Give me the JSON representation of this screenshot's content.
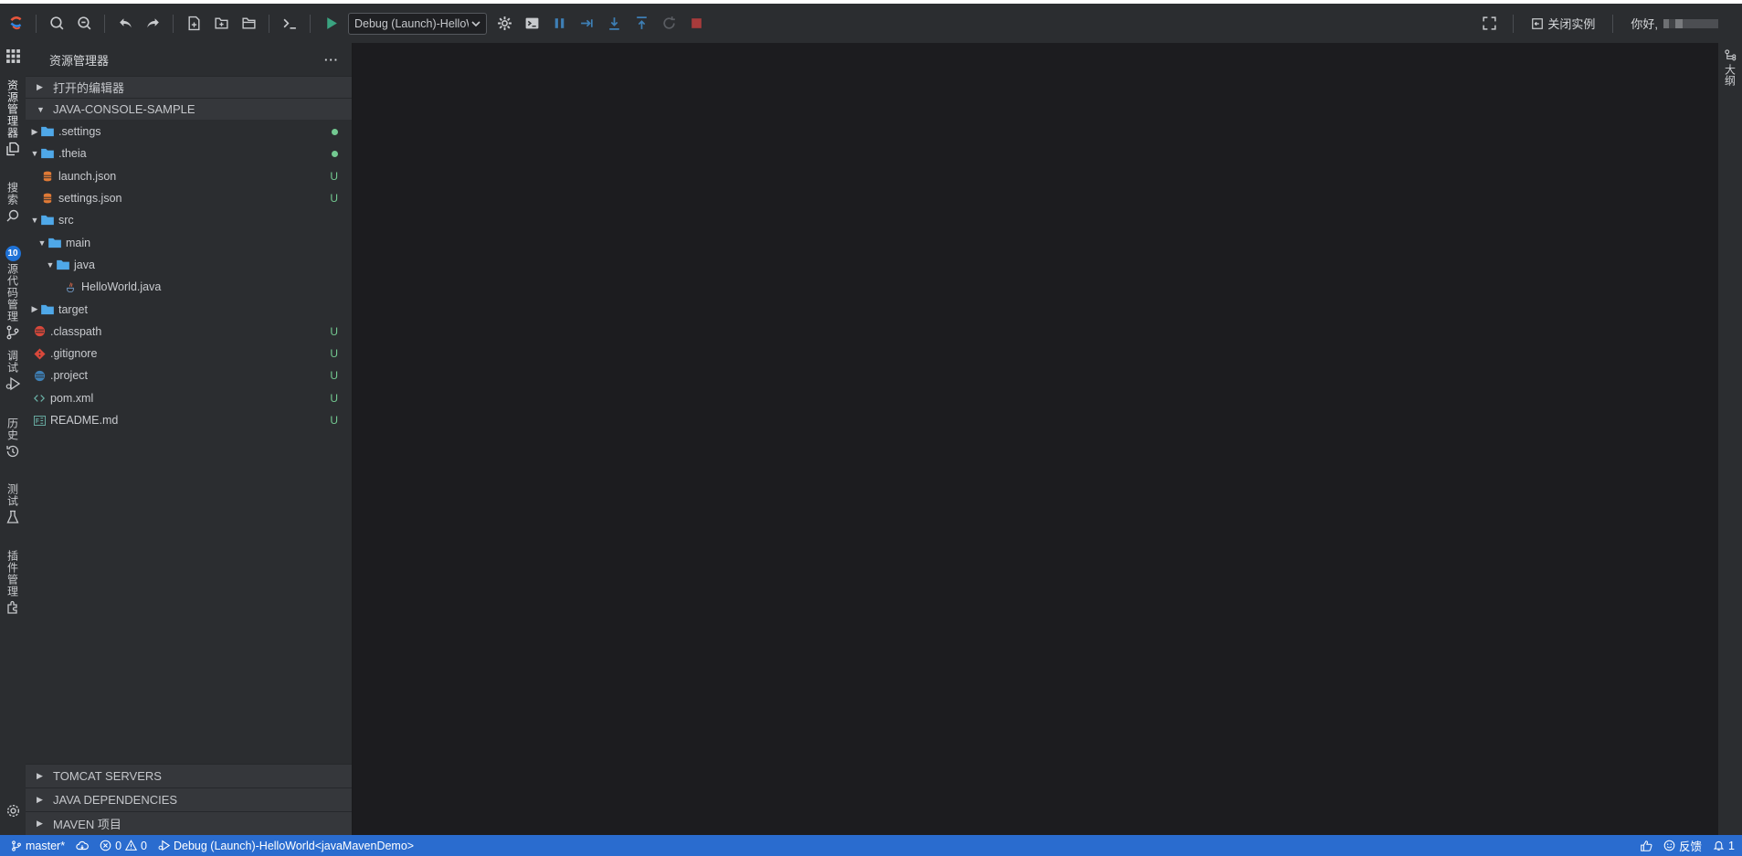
{
  "toolbar": {
    "debug_config": "Debug (Launch)-HelloWorld<javaMavenDemo>",
    "close_instance_label": "关闭实例",
    "greeting": "你好,"
  },
  "activity_bar": {
    "explorer_label": "资源管理器",
    "search_label": "搜索",
    "scm_label": "源代码管理",
    "scm_badge": "10",
    "debug_label": "调试",
    "history_label": "历史",
    "test_label": "测试",
    "plugins_label": "插件管理"
  },
  "sidebar": {
    "title": "资源管理器",
    "more": "···",
    "open_editors": "打开的编辑器",
    "project": "JAVA-CONSOLE-SAMPLE",
    "files": [
      {
        "name": ".settings",
        "status": "dot"
      },
      {
        "name": ".theia",
        "status": "dot"
      },
      {
        "name": "launch.json",
        "status": "U"
      },
      {
        "name": "settings.json",
        "status": "U"
      },
      {
        "name": "src",
        "status": ""
      },
      {
        "name": "main",
        "status": ""
      },
      {
        "name": "java",
        "status": ""
      },
      {
        "name": "HelloWorld.java",
        "status": ""
      },
      {
        "name": "target",
        "status": ""
      },
      {
        "name": ".classpath",
        "status": "U"
      },
      {
        "name": ".gitignore",
        "status": "U"
      },
      {
        "name": ".project",
        "status": "U"
      },
      {
        "name": "pom.xml",
        "status": "U"
      },
      {
        "name": "README.md",
        "status": "U"
      }
    ],
    "bottom_sections": [
      "TOMCAT SERVERS",
      "JAVA DEPENDENCIES",
      "MAVEN 项目"
    ]
  },
  "right_bar": {
    "outline_label": "大纲"
  },
  "statusbar": {
    "branch": "master*",
    "errors": "0",
    "warnings": "0",
    "debug": "Debug (Launch)-HelloWorld<javaMavenDemo>",
    "feedback": "反馈",
    "notifications": "1"
  },
  "colors": {
    "accent": "#2a6ccf",
    "folder": "#4fa8e8",
    "untracked": "#73c991",
    "editor_bg": "#1c1c1f"
  }
}
